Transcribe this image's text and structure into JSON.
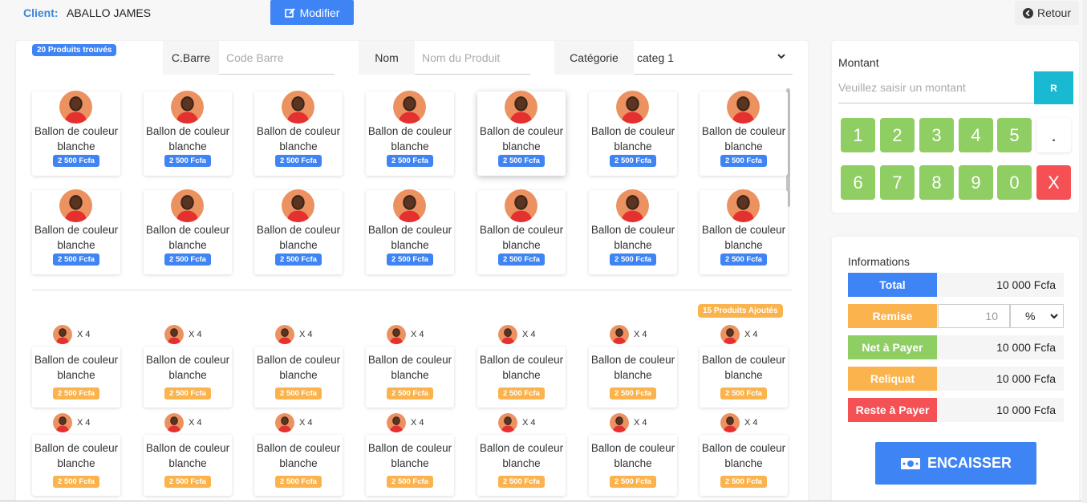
{
  "header": {
    "client_label": "Client:",
    "client_name": "ABALLO JAMES",
    "modifier_label": "Modifier",
    "retour_label": "Retour"
  },
  "search": {
    "found_badge": "20 Produits trouvés",
    "barcode_label": "C.Barre",
    "barcode_placeholder": "Code Barre",
    "name_label": "Nom",
    "name_placeholder": "Nom du Produit",
    "category_label": "Catégorie",
    "category_value": "categ 1"
  },
  "products": {
    "rows": [
      [
        {
          "name": "Ballon de couleur blanche",
          "price": "2 500 Fcfa"
        },
        {
          "name": "Ballon de couleur blanche",
          "price": "2 500 Fcfa"
        },
        {
          "name": "Ballon de couleur blanche",
          "price": "2 500 Fcfa"
        },
        {
          "name": "Ballon de couleur blanche",
          "price": "2 500 Fcfa"
        },
        {
          "name": "Ballon de couleur blanche",
          "price": "2 500 Fcfa"
        },
        {
          "name": "Ballon de couleur blanche",
          "price": "2 500 Fcfa"
        },
        {
          "name": "Ballon de couleur blanche",
          "price": "2 500 Fcfa"
        }
      ],
      [
        {
          "name": "Ballon de couleur blanche",
          "price": "2 500 Fcfa"
        },
        {
          "name": "Ballon de couleur blanche",
          "price": "2 500 Fcfa"
        },
        {
          "name": "Ballon de couleur blanche",
          "price": "2 500 Fcfa"
        },
        {
          "name": "Ballon de couleur blanche",
          "price": "2 500 Fcfa"
        },
        {
          "name": "Ballon de couleur blanche",
          "price": "2 500 Fcfa"
        },
        {
          "name": "Ballon de couleur blanche",
          "price": "2 500 Fcfa"
        },
        {
          "name": "Ballon de couleur blanche",
          "price": "2 500 Fcfa"
        }
      ]
    ]
  },
  "cart": {
    "added_badge": "15 Produits Ajoutés",
    "rows": [
      [
        {
          "name": "Ballon de couleur blanche",
          "price": "2 500 Fcfa",
          "qty": "X 4"
        },
        {
          "name": "Ballon de couleur blanche",
          "price": "2 500 Fcfa",
          "qty": "X 4"
        },
        {
          "name": "Ballon de couleur blanche",
          "price": "2 500 Fcfa",
          "qty": "X 4"
        },
        {
          "name": "Ballon de couleur blanche",
          "price": "2 500 Fcfa",
          "qty": "X 4"
        },
        {
          "name": "Ballon de couleur blanche",
          "price": "2 500 Fcfa",
          "qty": "X 4"
        },
        {
          "name": "Ballon de couleur blanche",
          "price": "2 500 Fcfa",
          "qty": "X 4"
        },
        {
          "name": "Ballon de couleur blanche",
          "price": "2 500 Fcfa",
          "qty": "X 4"
        }
      ],
      [
        {
          "name": "Ballon de couleur blanche",
          "price": "2 500 Fcfa",
          "qty": "X 4"
        },
        {
          "name": "Ballon de couleur blanche",
          "price": "2 500 Fcfa",
          "qty": "X 4"
        },
        {
          "name": "Ballon de couleur blanche",
          "price": "2 500 Fcfa",
          "qty": "X 4"
        },
        {
          "name": "Ballon de couleur blanche",
          "price": "2 500 Fcfa",
          "qty": "X 4"
        },
        {
          "name": "Ballon de couleur blanche",
          "price": "2 500 Fcfa",
          "qty": "X 4"
        },
        {
          "name": "Ballon de couleur blanche",
          "price": "2 500 Fcfa",
          "qty": "X 4"
        },
        {
          "name": "Ballon de couleur blanche",
          "price": "2 500 Fcfa",
          "qty": "X 4"
        }
      ]
    ]
  },
  "keypad": {
    "montant_label": "Montant",
    "montant_placeholder": "Veuillez saisir un montant",
    "reset_label": "R",
    "keys_row1": [
      "1",
      "2",
      "3",
      "4",
      "5",
      "."
    ],
    "keys_row2": [
      "6",
      "7",
      "8",
      "9",
      "0",
      "X"
    ]
  },
  "info": {
    "title": "Informations",
    "total_label": "Total",
    "total_value": "10 000 Fcfa",
    "remise_label": "Remise",
    "remise_value": "10",
    "remise_unit": "%",
    "net_label": "Net à Payer",
    "net_value": "10 000 Fcfa",
    "reliquat_label": "Reliquat",
    "reliquat_value": "10 000 Fcfa",
    "reste_label": "Reste à Payer",
    "reste_value": "10 000 Fcfa",
    "encaisser_label": "ENCAISSER"
  },
  "colors": {
    "primary": "#3f84f4",
    "warning": "#fbb34d",
    "success": "#8fce63",
    "danger": "#f55054",
    "info": "#19b9d1"
  }
}
